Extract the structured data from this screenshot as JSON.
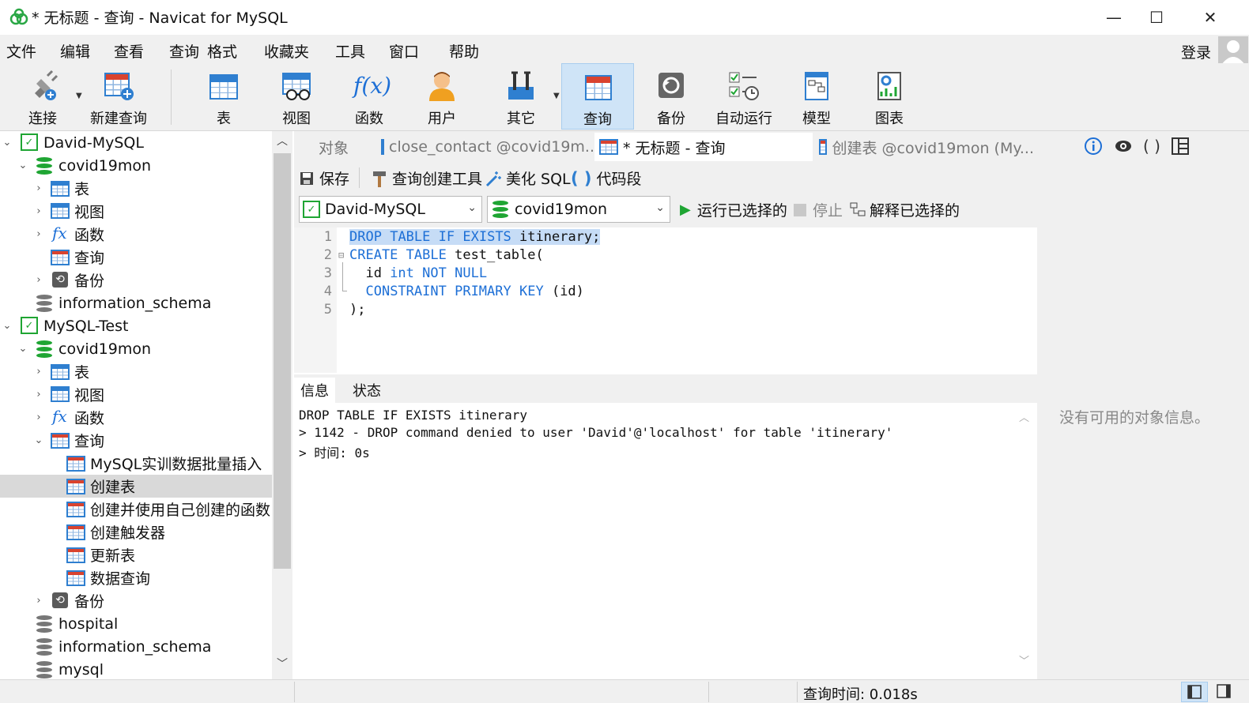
{
  "window": {
    "title": "* 无标题 - 查询 - Navicat for MySQL",
    "controls": {
      "minimize": "—",
      "maximize": "☐",
      "close": "✕"
    }
  },
  "menu": [
    "文件",
    "编辑",
    "查看",
    "查询",
    "格式",
    "收藏夹",
    "工具",
    "窗口",
    "帮助"
  ],
  "login_label": "登录",
  "toolbar": {
    "connect": "连接",
    "new_query": "新建查询",
    "table": "表",
    "view": "视图",
    "function": "函数",
    "user": "用户",
    "other": "其它",
    "query": "查询",
    "backup": "备份",
    "auto_run": "自动运行",
    "model": "模型",
    "chart": "图表",
    "fx_glyph": "f(x)"
  },
  "tree": {
    "conn1": "David-MySQL",
    "db1": "covid19mon",
    "db1_table": "表",
    "db1_view": "视图",
    "db1_func": "函数",
    "db1_query": "查询",
    "db1_backup": "备份",
    "db1_info": "information_schema",
    "conn2": "MySQL-Test",
    "db2": "covid19mon",
    "db2_table": "表",
    "db2_view": "视图",
    "db2_func": "函数",
    "db2_query": "查询",
    "q1": "MySQL实训数据批量插入",
    "q2": "创建表",
    "q3": "创建并使用自己创建的函数",
    "q4": "创建触发器",
    "q5": "更新表",
    "q6": "数据查询",
    "db2_backup": "备份",
    "db3": "hospital",
    "db4": "information_schema",
    "db5": "mysql"
  },
  "tabs": {
    "objects": "对象",
    "tab1": "close_contact @covid19m...",
    "tab2": "* 无标题 - 查询",
    "tab3": "创建表 @covid19mon (My..."
  },
  "query_toolbar": {
    "save": "保存",
    "builder": "查询创建工具",
    "beautify": "美化 SQL",
    "snippet": "代码段"
  },
  "connection_bar": {
    "connection": "David-MySQL",
    "database": "covid19mon",
    "run_selected": "运行已选择的",
    "stop": "停止",
    "explain_selected": "解释已选择的"
  },
  "editor": {
    "line_numbers": [
      "1",
      "2",
      "3",
      "4",
      "5"
    ]
  },
  "result_tabs": {
    "info": "信息",
    "status": "状态"
  },
  "result_lines": [
    "DROP TABLE IF EXISTS itinerary",
    "> 1142 - DROP command denied to user 'David'@'localhost' for table 'itinerary'",
    "> 时间: 0s"
  ],
  "right_panel": {
    "no_info": "没有可用的对象信息。"
  },
  "status_bar": {
    "query_time": "查询时间: 0.018s"
  },
  "colors": {
    "accent": "#1d6fd6",
    "mysql_green": "#1fa533",
    "selected_tab": "#cfe4f7"
  }
}
